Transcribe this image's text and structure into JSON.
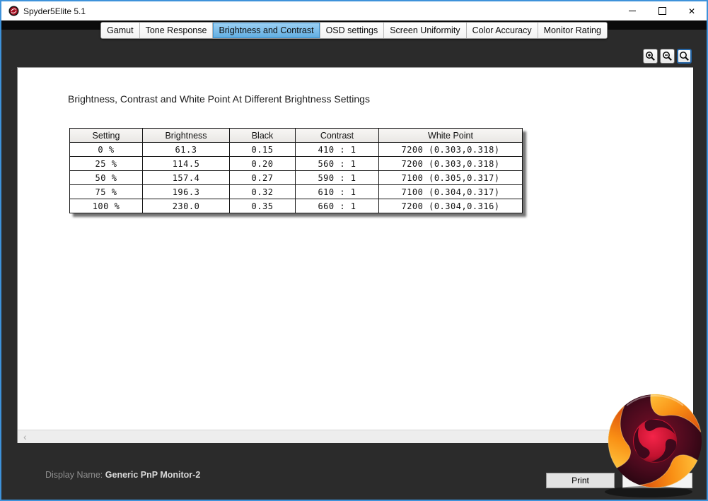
{
  "window": {
    "title": "Spyder5Elite 5.1"
  },
  "icons": {
    "close": "✕",
    "scroll_left": "‹"
  },
  "tabs": [
    {
      "label": "Gamut",
      "selected": false
    },
    {
      "label": "Tone Response",
      "selected": false
    },
    {
      "label": "Brightness and Contrast",
      "selected": true
    },
    {
      "label": "OSD settings",
      "selected": false
    },
    {
      "label": "Screen Uniformity",
      "selected": false
    },
    {
      "label": "Color Accuracy",
      "selected": false
    },
    {
      "label": "Monitor Rating",
      "selected": false
    }
  ],
  "page": {
    "title": "Brightness, Contrast and White Point At Different Brightness Settings",
    "table": {
      "columns": [
        "Setting",
        "Brightness",
        "Black",
        "Contrast",
        "White Point"
      ],
      "rows": [
        [
          "0 %",
          "61.3",
          "0.15",
          "410 : 1",
          "7200 (0.303,0.318)"
        ],
        [
          "25 %",
          "114.5",
          "0.20",
          "560 : 1",
          "7200 (0.303,0.318)"
        ],
        [
          "50 %",
          "157.4",
          "0.27",
          "590 : 1",
          "7100 (0.305,0.317)"
        ],
        [
          "75 %",
          "196.3",
          "0.32",
          "610 : 1",
          "7100 (0.304,0.317)"
        ],
        [
          "100 %",
          "230.0",
          "0.35",
          "660 : 1",
          "7200 (0.304,0.316)"
        ]
      ]
    }
  },
  "statusbar": {
    "display_name_label": "Display Name:",
    "display_name_value": "Generic PnP Monitor-2",
    "print_label": "Print"
  },
  "colors": {
    "accent_border": "#3e92da",
    "selected_tab": "#7fc0ec",
    "dark_background": "#2b2b2b"
  }
}
